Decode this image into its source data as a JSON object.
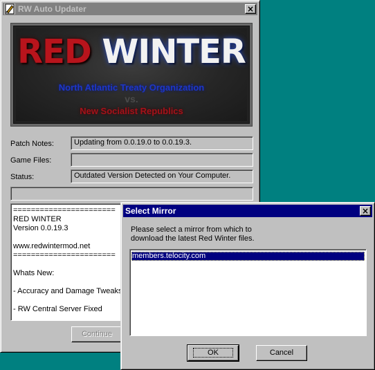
{
  "main_window": {
    "title": "RW Auto Updater",
    "close_label": "×",
    "banner": {
      "word1": "RED",
      "word2": "WINTER",
      "faction1": "North Atlantic Treaty Organization",
      "vs": "vs.",
      "faction2": "New Socialist Republics"
    },
    "fields": {
      "patch_notes_label": "Patch Notes:",
      "patch_notes_value": "Updating from 0.0.19.0 to 0.0.19.3.",
      "game_files_label": "Game Files:",
      "game_files_value": "",
      "status_label": "Status:",
      "status_value": "Outdated Version Detected on Your Computer."
    },
    "notes_lines": [
      "=======================",
      "RED WINTER",
      "Version 0.0.19.3",
      "",
      "www.redwintermod.net",
      "=======================",
      "",
      "Whats New:",
      "",
      "- Accuracy and Damage Tweaks",
      "",
      "- RW Central Server Fixed"
    ],
    "continue_label": "Continue"
  },
  "dialog": {
    "title": "Select Mirror",
    "close_label": "×",
    "message_line1": "Please select a mirror from which to",
    "message_line2": "download the latest Red Winter files.",
    "mirrors": [
      "members.telocity.com"
    ],
    "ok_label": "OK",
    "cancel_label": "Cancel"
  },
  "colors": {
    "desktop": "#008080",
    "active_title": "#000080",
    "inactive_title": "#808080"
  }
}
